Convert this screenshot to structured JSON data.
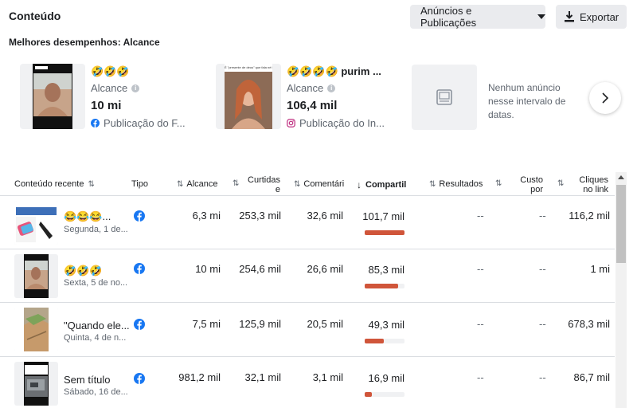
{
  "header": {
    "title": "Conteúdo",
    "ads_button": "Anúncios e Publicações",
    "export_button": "Exportar"
  },
  "top_performers": {
    "title": "Melhores desempenhos: Alcance",
    "cards": [
      {
        "emojis": "🤣🤣🤣",
        "metric_label": "Alcance",
        "value": "10 mi",
        "platform": "Publicação do F...",
        "platform_icon": "facebook-icon"
      },
      {
        "thumb_caption": "É \"presente de deus\" que fala né kk",
        "emojis": "🤣🤣🤣🤣 purim ...",
        "metric_label": "Alcance",
        "value": "106,4 mil",
        "platform": "Publicação do In...",
        "platform_icon": "instagram-icon"
      }
    ],
    "empty_card": "Nenhum anúncio nesse intervalo de datas."
  },
  "table": {
    "headers": {
      "content": "Conteúdo recente",
      "type": "Tipo",
      "reach": "Alcance",
      "likes": "Curtidas e",
      "comments": "Comentári",
      "shares": "Compartil",
      "results": "Resultados",
      "cost": "Custo por",
      "clicks": "Cliques no link"
    },
    "rows": [
      {
        "title": "😂😂😂...",
        "date": "Segunda, 1 de...",
        "reach": "6,3 mi",
        "likes": "253,3 mil",
        "comments": "32,6 mil",
        "shares": "101,7 mil",
        "shares_ratio": 1.0,
        "results": "--",
        "cost": "--",
        "clicks": "116,2 mil"
      },
      {
        "title": "🤣🤣🤣",
        "date": "Sexta, 5 de no...",
        "reach": "10 mi",
        "likes": "254,6 mil",
        "comments": "26,6 mil",
        "shares": "85,3 mil",
        "shares_ratio": 0.84,
        "results": "--",
        "cost": "--",
        "clicks": "1 mi"
      },
      {
        "title": "\"Quando ele...",
        "date": "Quinta, 4 de n...",
        "reach": "7,5 mi",
        "likes": "125,9 mil",
        "comments": "20,5 mil",
        "shares": "49,3 mil",
        "shares_ratio": 0.48,
        "results": "--",
        "cost": "--",
        "clicks": "678,3 mil"
      },
      {
        "title": "Sem título",
        "date": "Sábado, 16 de...",
        "reach": "981,2 mil",
        "likes": "32,1 mil",
        "comments": "3,1 mil",
        "shares": "16,9 mil",
        "shares_ratio": 0.17,
        "results": "--",
        "cost": "--",
        "clicks": "86,7 mil"
      }
    ]
  },
  "colors": {
    "bar": "#d0553a",
    "facebook": "#1877f2",
    "instagram": "#c13584"
  }
}
